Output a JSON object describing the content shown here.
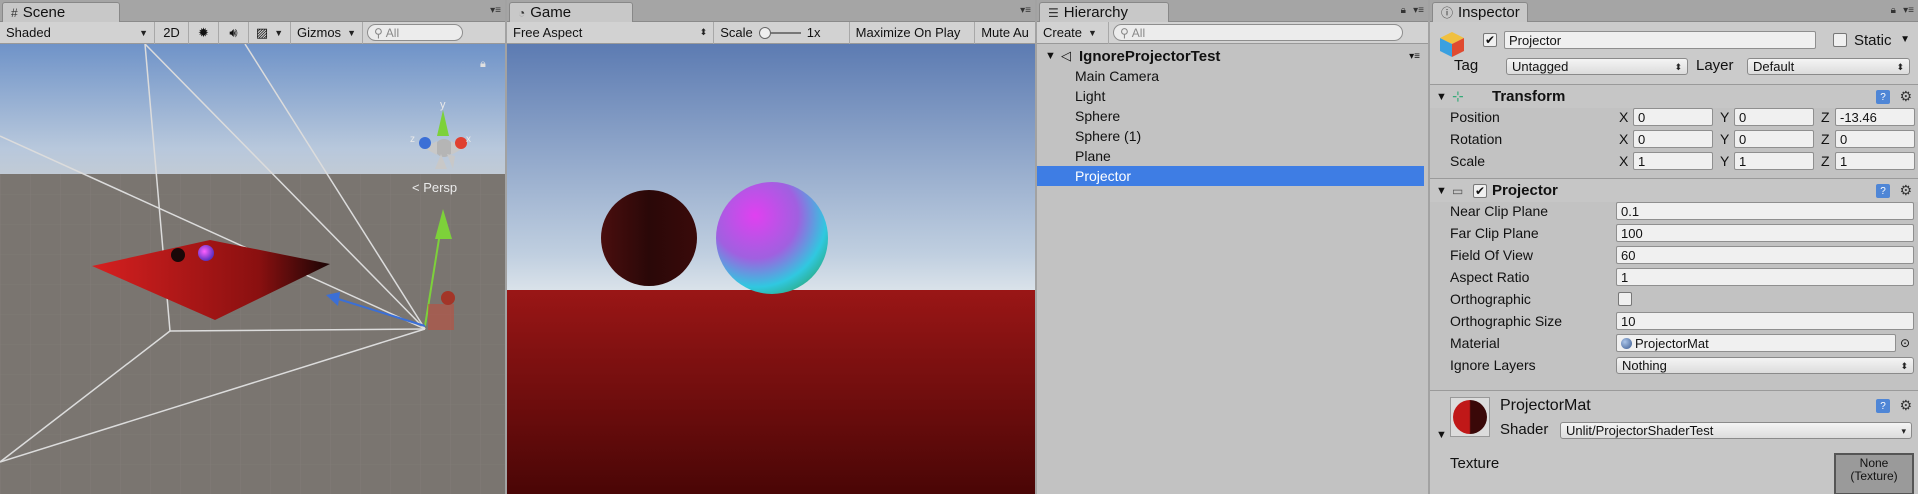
{
  "scene": {
    "tab": "Scene",
    "shading": "Shaded",
    "mode_2d": "2D",
    "gizmos": "Gizmos",
    "search_placeholder": "All",
    "persp_label": "< Persp",
    "axis_y": "y",
    "axis_x": "x",
    "axis_z": "z"
  },
  "game": {
    "tab": "Game",
    "aspect": "Free Aspect",
    "scale_label": "Scale",
    "scale_value": "1x",
    "maximize": "Maximize On Play",
    "mute": "Mute Au"
  },
  "hierarchy": {
    "tab": "Hierarchy",
    "create": "Create",
    "search_placeholder": "All",
    "scene_name": "IgnoreProjectorTest",
    "items": [
      "Main Camera",
      "Light",
      "Sphere",
      "Sphere (1)",
      "Plane",
      "Projector"
    ],
    "selected_index": 5
  },
  "inspector": {
    "tab": "Inspector",
    "object_name": "Projector",
    "static_label": "Static",
    "tag_label": "Tag",
    "tag_value": "Untagged",
    "layer_label": "Layer",
    "layer_value": "Default",
    "transform": {
      "title": "Transform",
      "position_label": "Position",
      "rotation_label": "Rotation",
      "scale_label": "Scale",
      "x_label": "X",
      "y_label": "Y",
      "z_label": "Z",
      "position": {
        "x": "0",
        "y": "0",
        "z": "-13.46"
      },
      "rotation": {
        "x": "0",
        "y": "0",
        "z": "0"
      },
      "scale": {
        "x": "1",
        "y": "1",
        "z": "1"
      }
    },
    "projector": {
      "title": "Projector",
      "near_label": "Near Clip Plane",
      "near_value": "0.1",
      "far_label": "Far Clip Plane",
      "far_value": "100",
      "fov_label": "Field Of View",
      "fov_value": "60",
      "aspect_label": "Aspect Ratio",
      "aspect_value": "1",
      "ortho_label": "Orthographic",
      "ortho_size_label": "Orthographic Size",
      "ortho_size_value": "10",
      "material_label": "Material",
      "material_value": "ProjectorMat",
      "ignore_label": "Ignore Layers",
      "ignore_value": "Nothing"
    },
    "material": {
      "name": "ProjectorMat",
      "shader_label": "Shader",
      "shader_value": "Unlit/ProjectorShaderTest",
      "texture_label": "Texture",
      "texture_value_line1": "None",
      "texture_value_line2": "(Texture)"
    }
  },
  "colors": {
    "selection": "#3e7de4",
    "panel_bg": "#c2c2c2",
    "game_floor": "#7a1010"
  }
}
